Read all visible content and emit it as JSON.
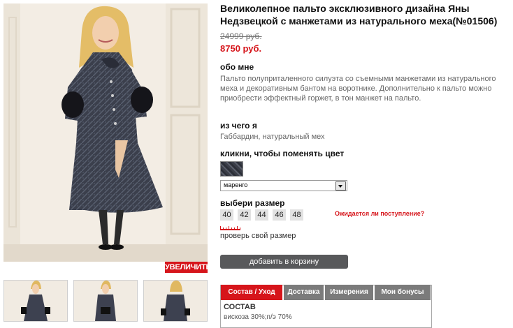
{
  "product": {
    "title": "Великолепное пальто эксклюзивного дизайна Яны Недзвецкой с манжетами из натурального меха(№01506)",
    "old_price": "24999 руб.",
    "new_price": "8750 руб."
  },
  "photo": {
    "zoom_label": "УВЕЛИЧИТЬ",
    "thumbnail_count": 3
  },
  "about": {
    "heading": "обо мне",
    "text": "Пальто полуприталенного силуэта со съемными манжетами из натурального меха и декоративным бантом на воротнике. Дополнительно к пальто можно приобрести эффектный горжет, в тон манжет на пальто."
  },
  "material": {
    "heading": "из чего я",
    "text": "Габбардин, натуральный мех"
  },
  "color": {
    "heading": "кликни, чтобы поменять цвет",
    "selected": "маренго"
  },
  "size": {
    "heading": "выбери размер",
    "options": [
      "40",
      "42",
      "44",
      "46",
      "48"
    ],
    "notify_link": "Ожидается ли поступление?",
    "check_link": "проверь свой размер"
  },
  "cart": {
    "button_label": "добавить в корзину"
  },
  "tabs": {
    "items": [
      "Состав / Уход",
      "Доставка",
      "Измерения",
      "Мои бонусы"
    ],
    "active_index": 0,
    "body_title": "СОСТАВ",
    "body_text": "вискоза 30%;п/э 70%"
  },
  "colors": {
    "accent": "#d6151b",
    "tab_inactive": "#7b7b7b",
    "button_dark": "#58595b"
  }
}
